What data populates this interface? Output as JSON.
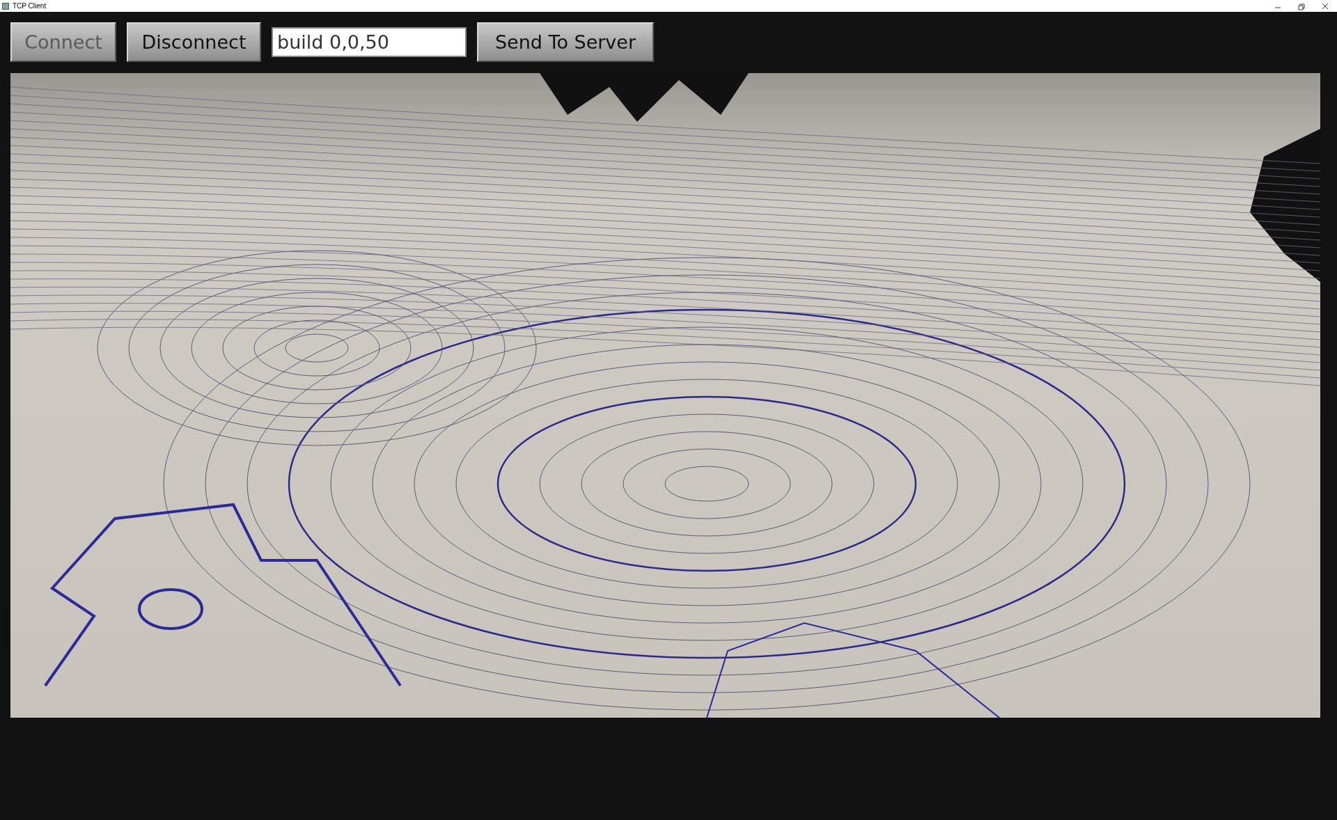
{
  "window": {
    "title": "TCP Client"
  },
  "toolbar": {
    "buttons": [
      {
        "label": "Connect",
        "disabled": true
      },
      {
        "label": "Disconnect",
        "disabled": false
      }
    ],
    "command_field": {
      "value": "build 0,0,50"
    },
    "send_button": {
      "label": "Send To Server",
      "disabled": false
    }
  }
}
